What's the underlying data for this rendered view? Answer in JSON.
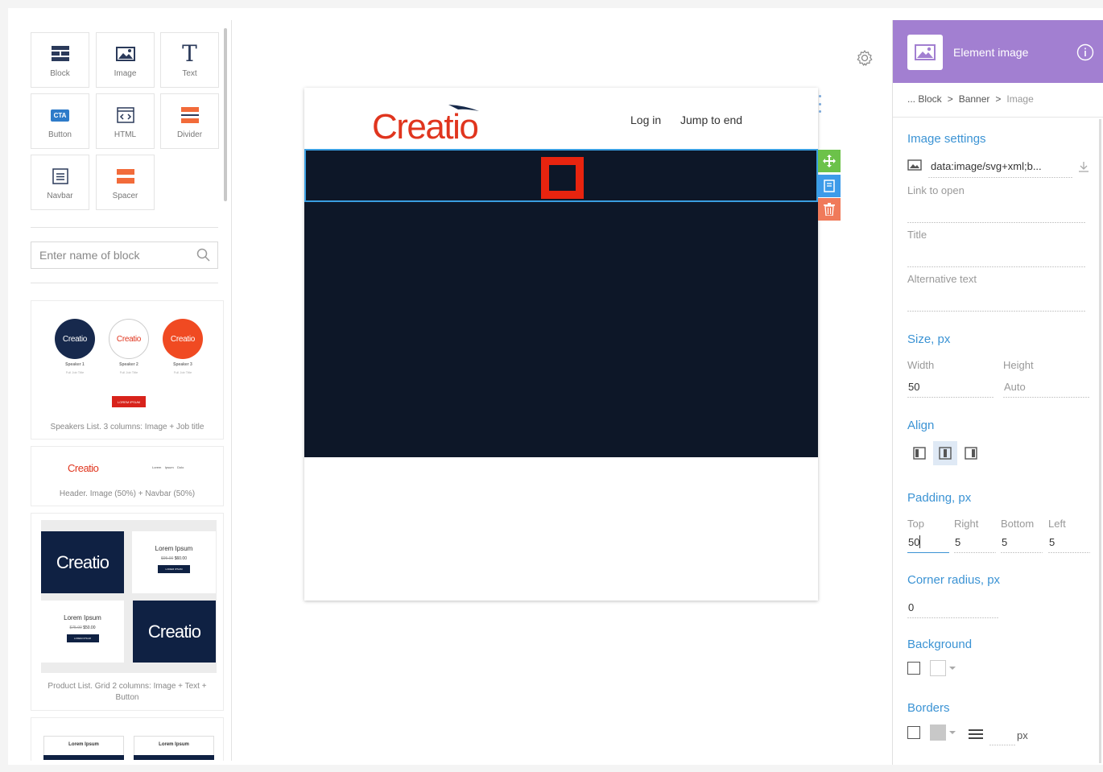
{
  "palette": {
    "tiles": [
      {
        "label": "Block",
        "icon": "block-icon"
      },
      {
        "label": "Image",
        "icon": "image-icon"
      },
      {
        "label": "Text",
        "icon": "text-icon"
      },
      {
        "label": "Button",
        "icon": "cta-button-icon",
        "badge": "CTA"
      },
      {
        "label": "HTML",
        "icon": "html-icon"
      },
      {
        "label": "Divider",
        "icon": "divider-icon"
      },
      {
        "label": "Navbar",
        "icon": "navbar-icon"
      },
      {
        "label": "Spacer",
        "icon": "spacer-icon"
      }
    ],
    "search_placeholder": "Enter name of block",
    "cards": {
      "speakers": {
        "logo_text": "Creatio",
        "speakers": [
          {
            "name": "Speaker 1",
            "title": "Full Job Title"
          },
          {
            "name": "Speaker 2",
            "title": "Full Job Title"
          },
          {
            "name": "Speaker 3",
            "title": "Full Job Title"
          }
        ],
        "button": "LOREM IPSUM",
        "label": "Speakers List. 3 columns: Image + Job title"
      },
      "header": {
        "logo_text": "Creatio",
        "nav": [
          "Lorem",
          "Ipsum",
          "Dolo"
        ],
        "label": "Header. Image (50%) + Navbar (50%)"
      },
      "product": {
        "logo_text": "Creatio",
        "item_title": "Lorem Ipsum",
        "price_old_1": "$95.00",
        "price_new_1": "$60.00",
        "price_old_2": "$75.00",
        "price_new_2": "$50.00",
        "button": "LOREM IPSUM",
        "label": "Product List. Grid 2 columns: Image + Text + Button"
      },
      "partial": {
        "col1": "Lorem Ipsum",
        "col2": "Lorem Ipsum"
      }
    }
  },
  "canvas": {
    "logo_text": "Creatio",
    "nav": [
      "Log in",
      "Jump to end"
    ],
    "colors": {
      "banner": "#0d1728",
      "accent_red": "#e8240f",
      "selection": "#3a9ee0"
    }
  },
  "panel": {
    "title": "Element image",
    "breadcrumb": [
      "... Block",
      "Banner",
      "Image"
    ],
    "image_settings": {
      "heading": "Image settings",
      "source": "data:image/svg+xml;b...",
      "link_label": "Link to open",
      "title_label": "Title",
      "alt_label": "Alternative text"
    },
    "size": {
      "heading": "Size, px",
      "width_label": "Width",
      "width": "50",
      "height_label": "Height",
      "height": "Auto"
    },
    "align": {
      "heading": "Align",
      "selected": "center"
    },
    "padding": {
      "heading": "Padding, px",
      "top_label": "Top",
      "top": "50",
      "right_label": "Right",
      "right": "5",
      "bottom_label": "Bottom",
      "bottom": "5",
      "left_label": "Left",
      "left": "5"
    },
    "corner": {
      "heading": "Corner radius, px",
      "value": "0"
    },
    "background": {
      "heading": "Background"
    },
    "borders": {
      "heading": "Borders",
      "unit": "px"
    },
    "colors": {
      "header": "#a27fd1",
      "section": "#3b93d4"
    }
  }
}
